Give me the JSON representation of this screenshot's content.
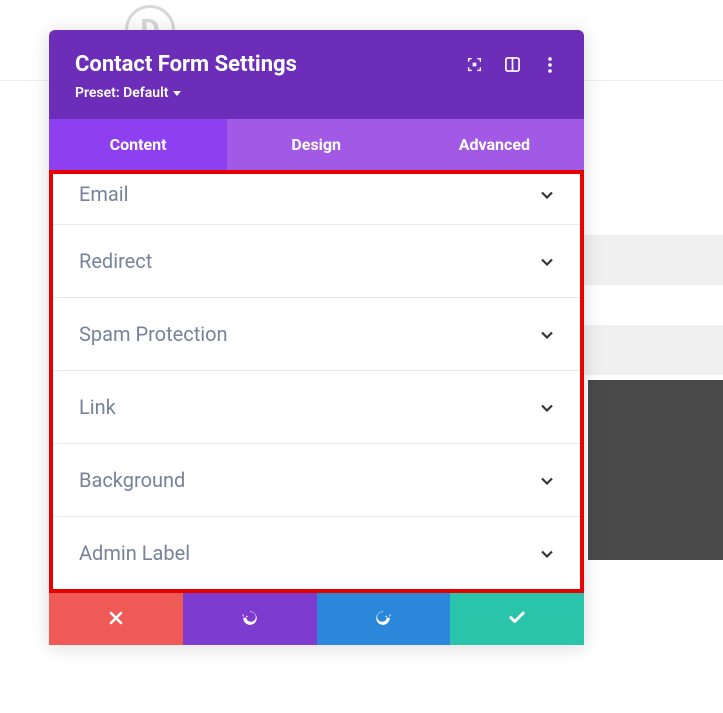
{
  "header": {
    "title": "Contact Form Settings",
    "preset_label": "Preset: Default"
  },
  "tabs": [
    {
      "label": "Content",
      "active": true
    },
    {
      "label": "Design",
      "active": false
    },
    {
      "label": "Advanced",
      "active": false
    }
  ],
  "accordion": [
    {
      "label": "Email"
    },
    {
      "label": "Redirect"
    },
    {
      "label": "Spam Protection"
    },
    {
      "label": "Link"
    },
    {
      "label": "Background"
    },
    {
      "label": "Admin Label"
    }
  ]
}
